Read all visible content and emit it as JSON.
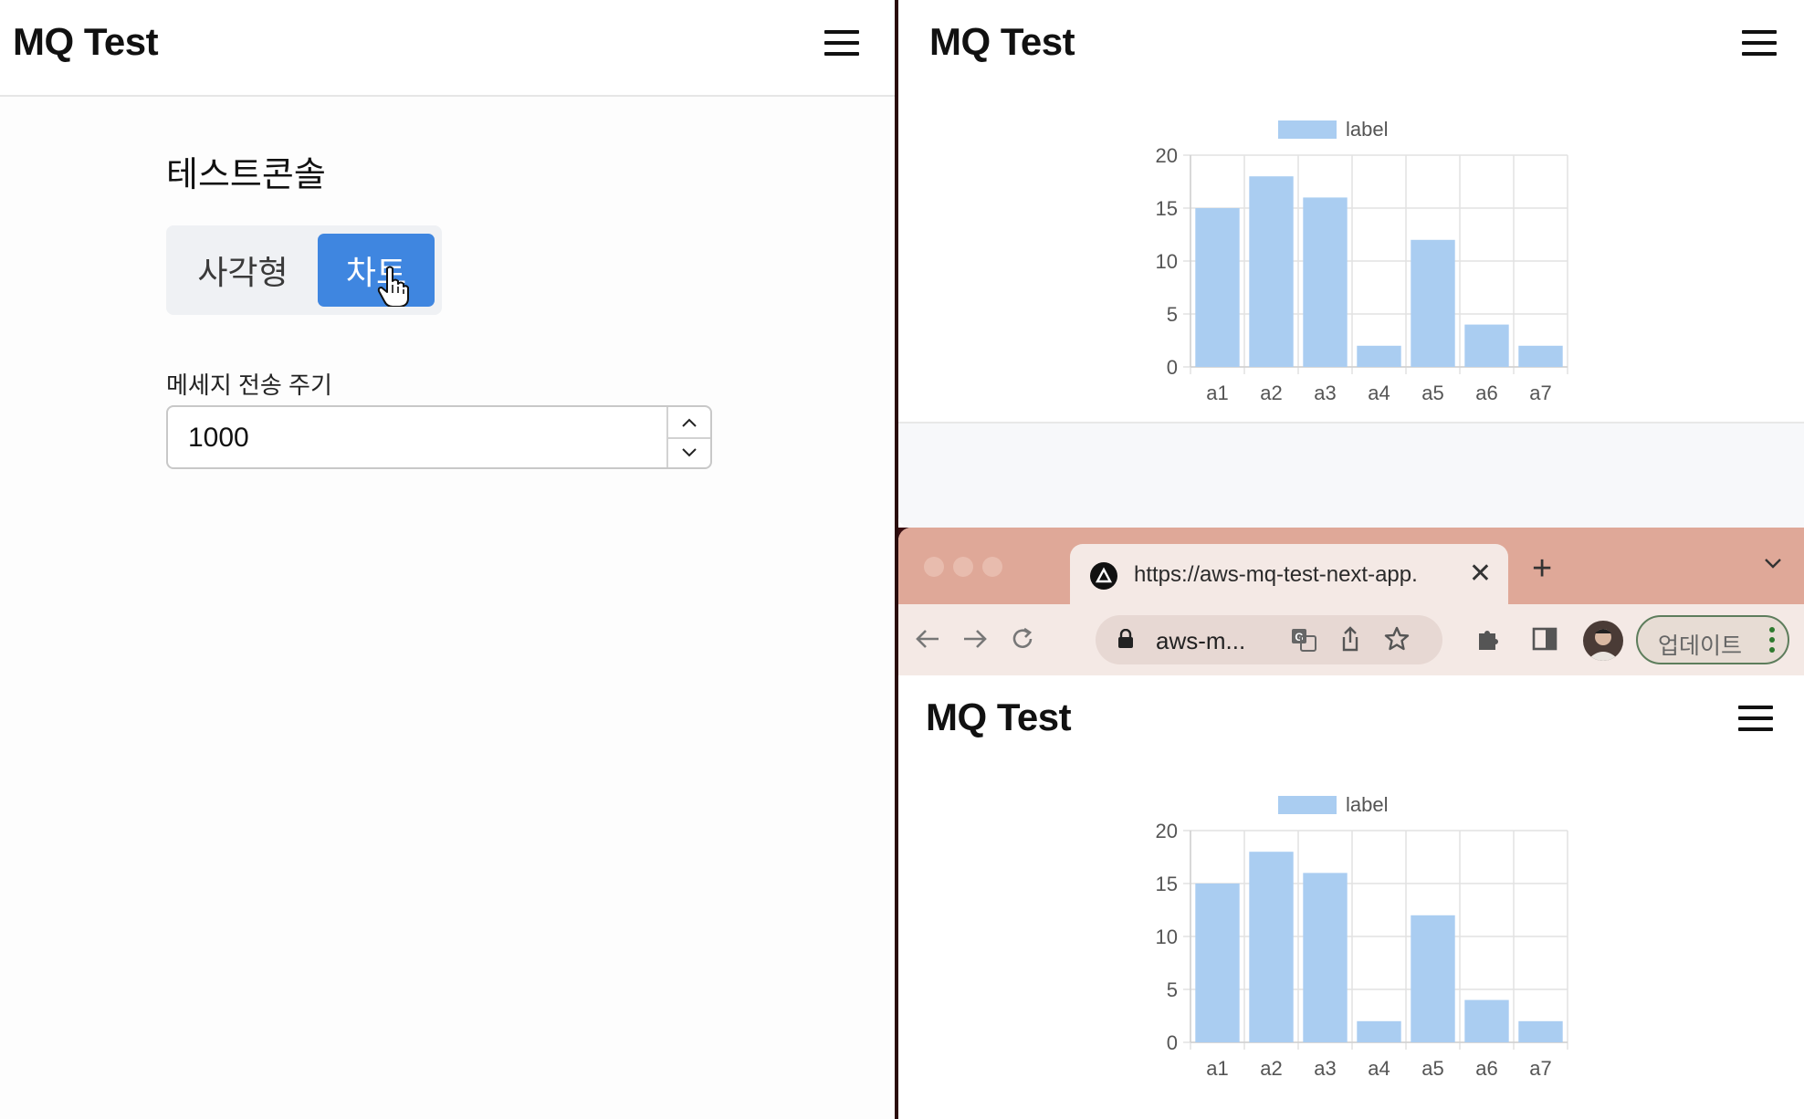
{
  "left": {
    "brand": "MQ Test",
    "console_title": "테스트콘솔",
    "toggle": {
      "option_1": "사각형",
      "option_2": "차트",
      "selected": "차트"
    },
    "interval_label": "메세지 전송 주기",
    "interval_value": "1000"
  },
  "right_top": {
    "brand": "MQ Test"
  },
  "browser": {
    "tab_title": "https://aws-mq-test-next-app.",
    "url": "aws-m...",
    "update_label": "업데이트",
    "brand": "MQ Test"
  },
  "chart_data": [
    {
      "type": "bar",
      "categories": [
        "a1",
        "a2",
        "a3",
        "a4",
        "a5",
        "a6",
        "a7"
      ],
      "series": [
        {
          "name": "label",
          "values": [
            15,
            18,
            16,
            2,
            12,
            4,
            2
          ]
        }
      ],
      "ylim": [
        0,
        20
      ],
      "yticks": [
        0,
        5,
        10,
        15,
        20
      ],
      "legend": "top",
      "grid": true,
      "bar_color": "#aacdf1"
    },
    {
      "type": "bar",
      "categories": [
        "a1",
        "a2",
        "a3",
        "a4",
        "a5",
        "a6",
        "a7"
      ],
      "series": [
        {
          "name": "label",
          "values": [
            15,
            18,
            16,
            2,
            12,
            4,
            2
          ]
        }
      ],
      "ylim": [
        0,
        20
      ],
      "yticks": [
        0,
        5,
        10,
        15,
        20
      ],
      "legend": "top",
      "grid": true,
      "bar_color": "#aacdf1"
    }
  ],
  "colors": {
    "accent": "#3f86e0",
    "tabstrip": "#dfa898",
    "toolbar": "#f4e9e5"
  }
}
